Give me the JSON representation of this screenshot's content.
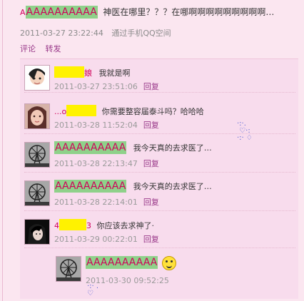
{
  "post": {
    "author_prefix": "A",
    "author_name": "AAAAAAAAAA",
    "text": "神医在哪里？？？在哪啊啊啊啊啊啊啊啊啊…",
    "time": "2011-03-27 23:22:44",
    "source": "通过手机QQ空间",
    "actions": [
      "评论",
      "转发"
    ]
  },
  "comments": [
    {
      "name_suffix": "娘",
      "text": "我就是啊",
      "time": "2011-03-27 23:51:06",
      "reply": "回复"
    },
    {
      "name_prefix": "...o",
      "text": "你需要整容届泰斗吗？哈哈哈",
      "time": "2011-03-28 11:52:04",
      "reply": "回复"
    },
    {
      "name": "AAAAAAAAAA",
      "text": "我今天真的去求医了…",
      "time": "2011-03-28 22:13:47",
      "reply": "回复"
    },
    {
      "name": "AAAAAAAAAA",
      "text": "我今天真的去求医了…",
      "time": "2011-03-28 22:14:01",
      "reply": "回复"
    },
    {
      "name_prefix": "4",
      "name_suffix": "3",
      "text": "你应该去求神了·",
      "time": "2011-03-29 00:22:01",
      "reply": "回复"
    },
    {
      "name": "AAAAAAAAAA",
      "time": "2011-03-30 09:52:25",
      "emoji": "smiley-icon"
    }
  ]
}
